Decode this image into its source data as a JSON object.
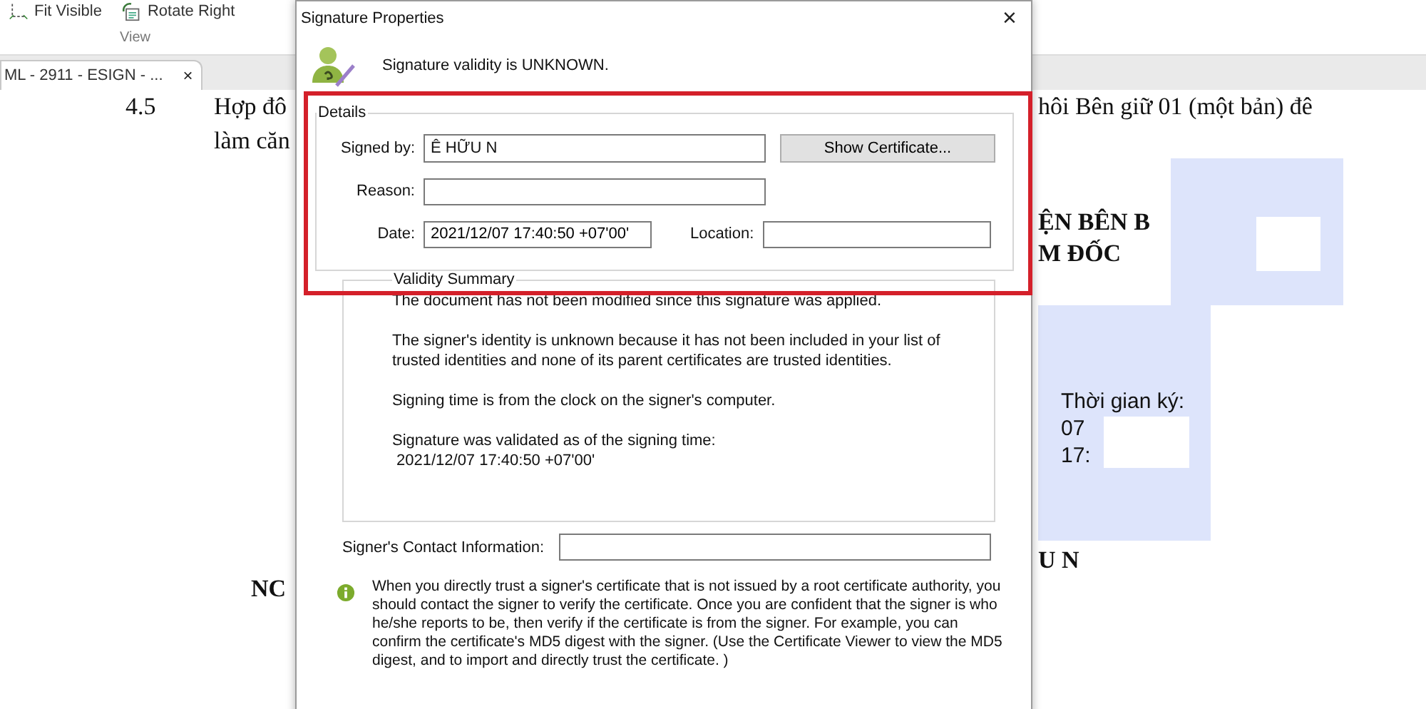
{
  "toolbar": {
    "buttons": [
      {
        "label": "Fit Visible",
        "kind": "fit"
      },
      {
        "label": "Rotate Right",
        "kind": "rotate"
      }
    ],
    "group_label": "View"
  },
  "document_tab": {
    "title": "ML - 2911 - ESIGN - ...",
    "close": "×"
  },
  "document": {
    "left_lines": [
      {
        "number": "4.5",
        "text": "Hợp đô"
      },
      {
        "text": "làm căn"
      }
    ],
    "left_footer": "NC",
    "right_line": "hôi Bên giữ 01 (một bản) đê",
    "right_heading": [
      "ỆN BÊN B",
      "M ĐỐC"
    ],
    "stamp_lines": [
      "Thời gian ký:",
      "07",
      "17:"
    ],
    "right_footer": "U N"
  },
  "dialog": {
    "title": "Signature Properties",
    "close": "×",
    "status": "Signature validity is UNKNOWN.",
    "details": {
      "legend": "Details",
      "signed_by_label": "Signed by:",
      "signed_by_value": "Ê HỮU N",
      "show_certificate": "Show Certificate...",
      "reason_label": "Reason:",
      "date_label": "Date:",
      "date_value": "2021/12/07 17:40:50 +07'00'",
      "location_label": "Location:"
    },
    "validity_summary": {
      "legend": "Validity Summary",
      "paragraphs": [
        [
          "The document has not been modified since this signature was applied."
        ],
        [
          "The signer's identity is unknown because it has not been included in your list of trusted identities and none of its parent certificates are trusted identities."
        ],
        [
          "Signing time is from the clock on the signer's computer."
        ],
        [
          "Signature was validated as of the signing time:",
          "2021/12/07 17:40:50 +07'00'"
        ]
      ]
    },
    "contact_label": "Signer's Contact Information:",
    "info": "When you directly trust a signer's certificate that is not issued by a root certificate authority, you should contact the signer to verify the certificate. Once you are confident that the signer is who he/she reports to be, then verify if the certificate is from the signer. For example, you can confirm the certificate's MD5 digest with the signer. (Use the Certificate Viewer to view the MD5 digest, and to import and directly trust the certificate. )"
  }
}
